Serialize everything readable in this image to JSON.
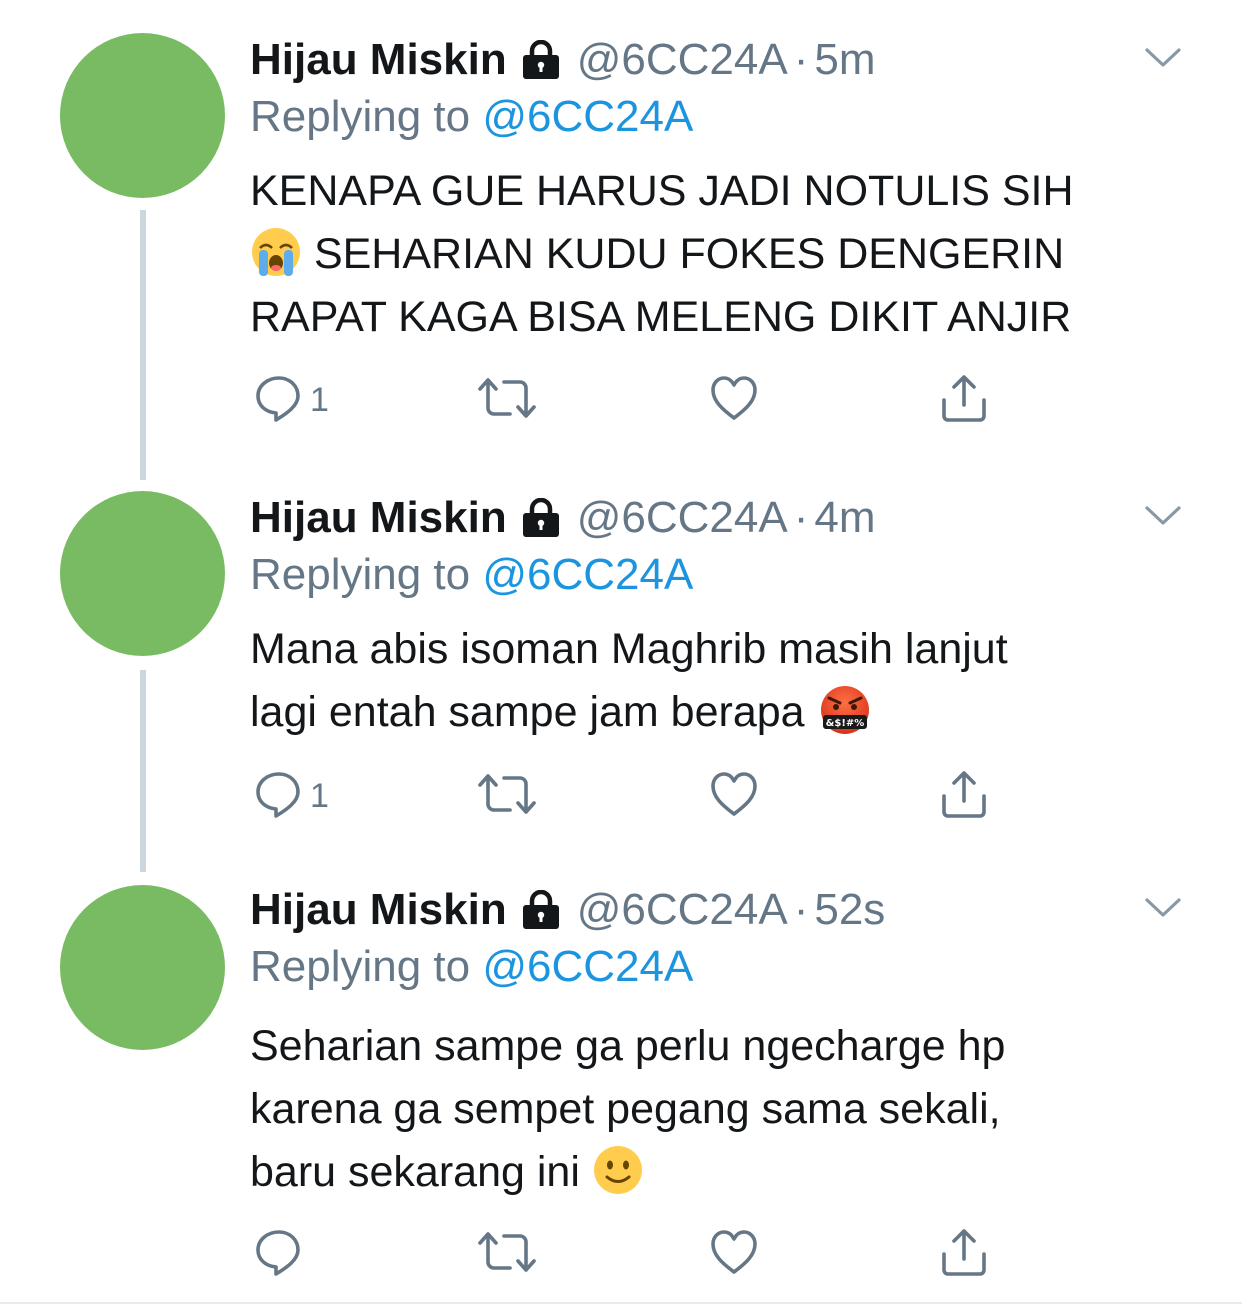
{
  "tweets": [
    {
      "name": "Hijau Miskin",
      "handle": "@6CC24A",
      "separator": "·",
      "time": "5m",
      "replying_prefix": "Replying to ",
      "replying_handle": "@6CC24A",
      "text_lines": [
        "KENAPA GUE HARUS JADI NOTULIS SIH",
        " SEHARIAN KUDU FOKES DENGERIN",
        "RAPAT KAGA BISA MELENG DIKIT ANJIR"
      ],
      "emoji": "loudly-crying-face",
      "reply_count": "1"
    },
    {
      "name": "Hijau Miskin",
      "handle": "@6CC24A",
      "separator": "·",
      "time": "4m",
      "replying_prefix": "Replying to ",
      "replying_handle": "@6CC24A",
      "text_lines": [
        "Mana abis isoman Maghrib masih lanjut",
        "lagi entah sampe jam berapa "
      ],
      "emoji": "face-with-symbols-on-mouth",
      "emoji_text": "&$!#%",
      "reply_count": "1"
    },
    {
      "name": "Hijau Miskin",
      "handle": "@6CC24A",
      "separator": "·",
      "time": "52s",
      "replying_prefix": "Replying to ",
      "replying_handle": "@6CC24A",
      "text_lines": [
        "Seharian sampe ga perlu ngecharge hp",
        "karena ga sempet pegang sama sekali,",
        "baru sekarang ini "
      ],
      "emoji": "slightly-smiling-face",
      "reply_count": ""
    }
  ],
  "colors": {
    "avatar": "#79bb62",
    "link": "#1b95e0",
    "muted": "#657786",
    "thread_line": "#ccd6dd"
  }
}
